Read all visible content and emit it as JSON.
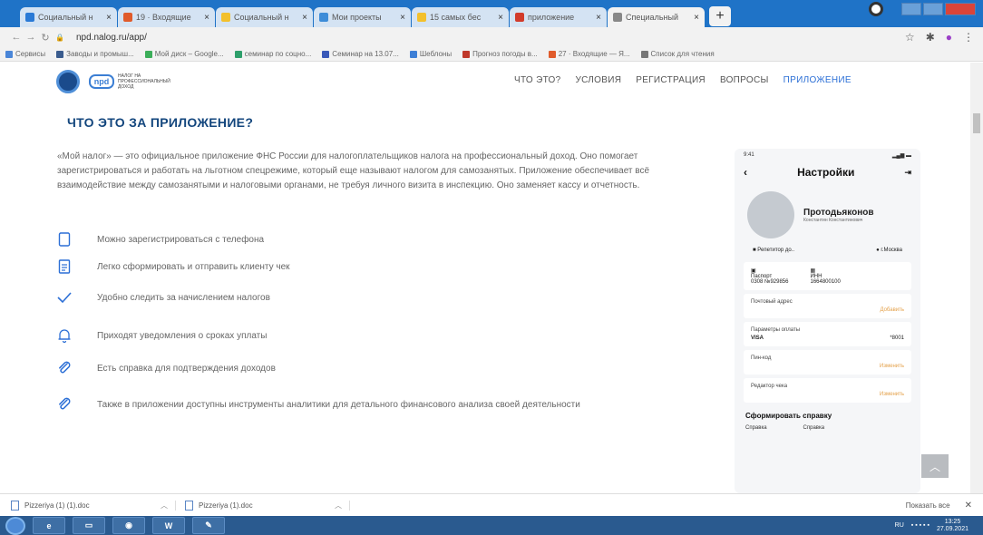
{
  "browser": {
    "tabs": [
      {
        "title": "Социальный н",
        "color": "#2a7ad6",
        "active": false
      },
      {
        "title": "19 · Входящие",
        "color": "#e05b2b",
        "active": false
      },
      {
        "title": "Социальный н",
        "color": "#f3c02c",
        "active": false
      },
      {
        "title": "Мои проекты",
        "color": "#3d8cd8",
        "active": false
      },
      {
        "title": "15 самых бес",
        "color": "#f3c02c",
        "active": false
      },
      {
        "title": "приложение",
        "color": "#d23b2b",
        "active": false
      },
      {
        "title": "Специальный",
        "color": "#888888",
        "active": true
      }
    ],
    "new_tab": "+",
    "url": "npd.nalog.ru/app/",
    "bookmarks": [
      {
        "label": "Сервисы",
        "color": "#4a86d8"
      },
      {
        "label": "Заводы и промыш...",
        "color": "#3a5c8e"
      },
      {
        "label": "Мой диск – Google...",
        "color": "#3cae5a"
      },
      {
        "label": "семинар по соцно...",
        "color": "#2e9f6b"
      },
      {
        "label": "Семинар на 13.07...",
        "color": "#3958b8"
      },
      {
        "label": "Шеблоны",
        "color": "#3d7fd6"
      },
      {
        "label": "Прогноз погоды в...",
        "color": "#c0392b"
      },
      {
        "label": "27 · Входящие — Я...",
        "color": "#e05b2b"
      },
      {
        "label": "Список для чтения",
        "color": "#777777"
      }
    ]
  },
  "site": {
    "logo_text": "НАЛОГ НА ПРОФЕССИОНАЛЬНЫЙ ДОХОД",
    "menu": [
      {
        "label": "ЧТО ЭТО?",
        "active": false
      },
      {
        "label": "УСЛОВИЯ",
        "active": false
      },
      {
        "label": "РЕГИСТРАЦИЯ",
        "active": false
      },
      {
        "label": "ВОПРОСЫ",
        "active": false
      },
      {
        "label": "ПРИЛОЖЕНИЕ",
        "active": true
      }
    ]
  },
  "main": {
    "title": "ЧТО ЭТО ЗА ПРИЛОЖЕНИЕ?",
    "intro": "«Мой налог» — это официальное приложение ФНС России для налогоплательщиков налога на профессиональный доход. Оно помогает зарегистрироваться и работать на льготном спецрежиме, который еще называют налогом для самозанятых. Приложение обеспечивает всё взаимодействие между самозанятыми и налоговыми органами, не требуя личного визита в инспекцию. Оно заменяет кассу и отчетность.",
    "features": [
      {
        "icon": "phone-icon",
        "text": "Можно зарегистрироваться с телефона"
      },
      {
        "icon": "receipt-icon",
        "text": "Легко сформировать и отправить клиенту чек"
      },
      {
        "icon": "check-icon",
        "text": "Удобно следить за начислением налогов"
      },
      {
        "icon": "bell-icon",
        "text": "Приходят уведомления о сроках уплаты"
      },
      {
        "icon": "paperclip-icon",
        "text": "Есть справка для подтверждения доходов"
      },
      {
        "icon": "paperclip-icon",
        "text": "Также в приложении доступны инструменты аналитики для детального финансового анализа своей деятельности"
      }
    ]
  },
  "phone": {
    "time": "9:41",
    "screen_title": "Настройки",
    "name": "Протодьяконов",
    "subname": "Константин Константинович",
    "job": "Репетитор до..",
    "city": "г.Москва",
    "passport_label": "Паспорт",
    "passport_value": "0308 №929856",
    "inn_label": "ИНН",
    "inn_value": "1664800100",
    "mail_label": "Почтовый адрес",
    "add_link": "Добавить",
    "payment_label": "Параметры оплаты",
    "visa": "VISA",
    "card_tail": "*8001",
    "pin_label": "Пин-код",
    "change_link": "Изменить",
    "receipt_editor": "Редактор чека",
    "change_link2": "Изменить",
    "make_ref": "Сформировать справку",
    "ref_a": "Справка",
    "ref_b": "Справка"
  },
  "downloads": {
    "items": [
      {
        "name": "Pizzeriya (1) (1).doc"
      },
      {
        "name": "Pizzeriya (1).doc"
      }
    ],
    "show_all": "Показать все",
    "close": "✕"
  },
  "taskbar": {
    "lang": "RU",
    "time": "13:25",
    "date": "27.09.2021"
  }
}
